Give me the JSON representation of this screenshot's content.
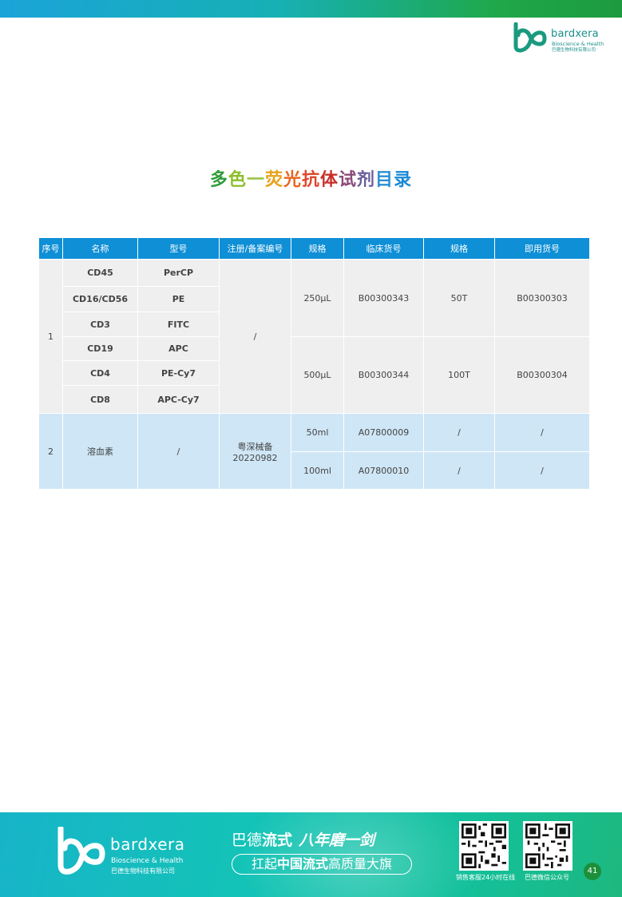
{
  "header": {
    "brand": "bardxera",
    "brand_en": "Bioscience & Health",
    "brand_cn": "巴德生物科技有限公司"
  },
  "title": {
    "chars": [
      "多",
      "色",
      "一",
      "荧",
      "光",
      "抗",
      "体",
      "试",
      "剂",
      "目",
      "录"
    ],
    "colors": [
      "#2e9b3a",
      "#8cbf2a",
      "#9bc54a",
      "#e7a21b",
      "#e8661f",
      "#e0462b",
      "#c7302a",
      "#8b4a7a",
      "#6a5e9c",
      "#2a8fd0",
      "#1a88d6"
    ]
  },
  "table": {
    "headers": [
      "序号",
      "名称",
      "型号",
      "注册/备案编号",
      "规格",
      "临床货号",
      "规格",
      "即用货号"
    ],
    "group1": {
      "index": "1",
      "names": [
        "CD45",
        "CD16/CD56",
        "CD3",
        "CD19",
        "CD4",
        "CD8"
      ],
      "models": [
        "PerCP",
        "PE",
        "FITC",
        "APC",
        "PE-Cy7",
        "APC-Cy7"
      ],
      "reg_no": "/",
      "rows": [
        {
          "spec": "250μL",
          "clinical_no": "B00300343",
          "spec2": "50T",
          "ready_no": "B00300303"
        },
        {
          "spec": "500μL",
          "clinical_no": "B00300344",
          "spec2": "100T",
          "ready_no": "B00300304"
        }
      ]
    },
    "group2": {
      "index": "2",
      "name": "溶血素",
      "model": "/",
      "reg_line1": "粤深械备",
      "reg_line2": "20220982",
      "rows": [
        {
          "spec": "50ml",
          "clinical_no": "A07800009",
          "spec2": "/",
          "ready_no": "/"
        },
        {
          "spec": "100ml",
          "clinical_no": "A07800010",
          "spec2": "/",
          "ready_no": "/"
        }
      ]
    }
  },
  "footer": {
    "brand": "bardxera",
    "brand_en": "Bioscience & Health",
    "brand_cn": "巴德生物科技有限公司",
    "slogan_a": "巴德",
    "slogan_b": "流式",
    "slogan_c": "八年磨一剑",
    "slogan2_a": "扛起",
    "slogan2_b": "中国流式",
    "slogan2_c": "高质量大旗",
    "qr1_label": "销售客服24小时在线",
    "qr2_label": "巴德微信公众号",
    "page_number": "41"
  }
}
